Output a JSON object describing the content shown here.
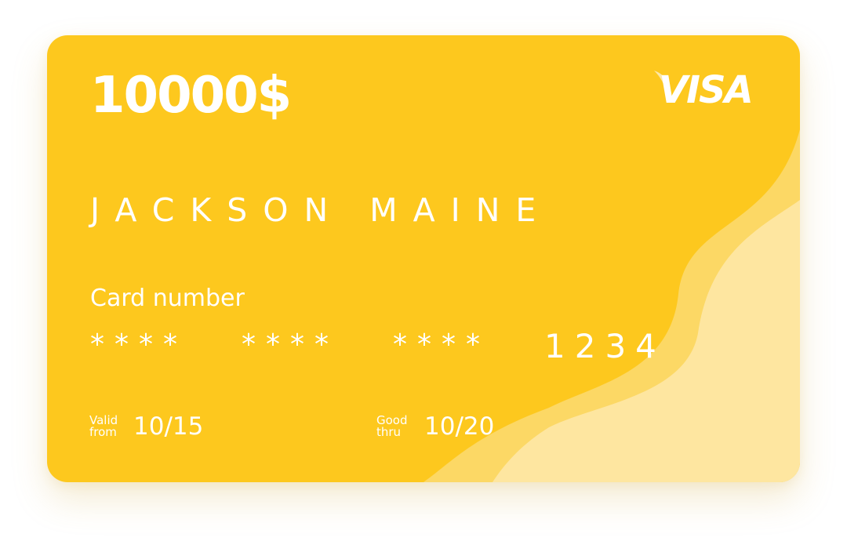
{
  "card": {
    "balance": "10000$",
    "brand": "VISA",
    "holder_name": "JACKSON MAINE",
    "number_label": "Card number",
    "number_groups": [
      "****",
      "****",
      "****",
      "1234"
    ],
    "valid_from": {
      "label_line1": "Valid",
      "label_line2": "from",
      "value": "10/15"
    },
    "good_thru": {
      "label_line1": "Good",
      "label_line2": "thru",
      "value": "10/20"
    }
  },
  "colors": {
    "card_background": "#fdc81e",
    "wave_light": "#fde397",
    "wave_lighter": "#fee9a8",
    "text": "#ffffff"
  }
}
